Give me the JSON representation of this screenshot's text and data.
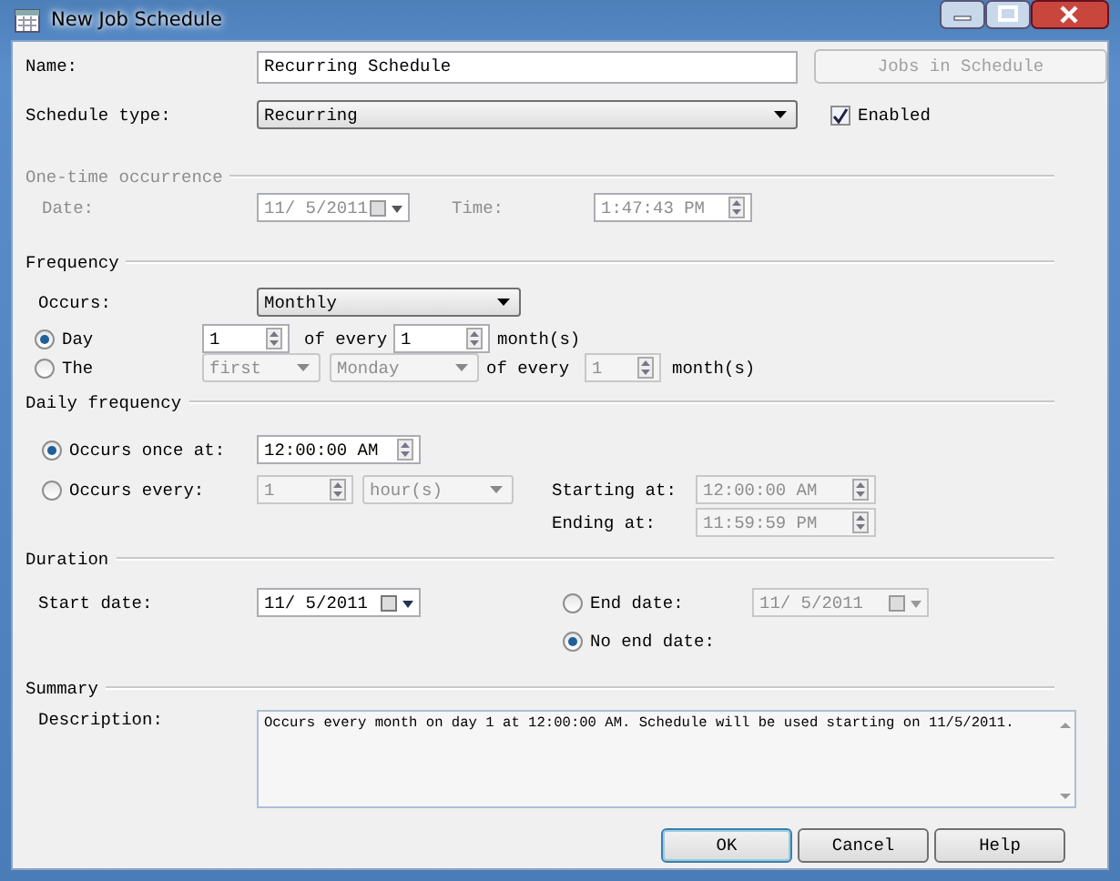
{
  "window": {
    "title": "New Job Schedule"
  },
  "name": {
    "label": "Name:",
    "value": "Recurring Schedule"
  },
  "jobs_button": {
    "label": "Jobs in Schedule",
    "disabled": true
  },
  "schedule_type": {
    "label": "Schedule type:",
    "value": "Recurring"
  },
  "enabled": {
    "label": "Enabled",
    "checked": true
  },
  "one_time": {
    "title": "One-time occurrence",
    "disabled": true,
    "date_label": "Date:",
    "date_value": "11/ 5/2011",
    "time_label": "Time:",
    "time_value": "1:47:43 PM"
  },
  "frequency": {
    "title": "Frequency",
    "occurs_label": "Occurs:",
    "occurs_value": "Monthly",
    "options": [
      {
        "kind": "day",
        "label": "Day",
        "selected": true,
        "day": "1",
        "of_every": "of every",
        "months": "1",
        "unit": "month(s)"
      },
      {
        "kind": "weekday",
        "label": "The",
        "selected": false,
        "ordinal": "first",
        "weekday": "Monday",
        "of_every": "of every",
        "months": "1",
        "unit": "month(s)"
      }
    ]
  },
  "daily": {
    "title": "Daily frequency",
    "options": [
      {
        "kind": "once",
        "label": "Occurs once at:",
        "selected": true,
        "time": "12:00:00 AM"
      },
      {
        "kind": "every",
        "label": "Occurs every:",
        "selected": false,
        "interval": "1",
        "unit": "hour(s)"
      }
    ],
    "starting_label": "Starting at:",
    "starting_value": "12:00:00 AM",
    "ending_label": "Ending at:",
    "ending_value": "11:59:59 PM"
  },
  "duration": {
    "title": "Duration",
    "start_label": "Start date:",
    "start_value": "11/ 5/2011",
    "end_options": [
      {
        "kind": "end_date",
        "label": "End date:",
        "selected": false,
        "date": "11/ 5/2011"
      },
      {
        "kind": "no_end",
        "label": "No end date:",
        "selected": true
      }
    ]
  },
  "summary": {
    "title": "Summary",
    "description_label": "Description:",
    "description": "Occurs every month on day 1 at 12:00:00 AM. Schedule will be used starting on 11/5/2011."
  },
  "buttons": [
    {
      "label": "OK",
      "default": true
    },
    {
      "label": "Cancel",
      "default": false
    },
    {
      "label": "Help",
      "default": false
    }
  ]
}
